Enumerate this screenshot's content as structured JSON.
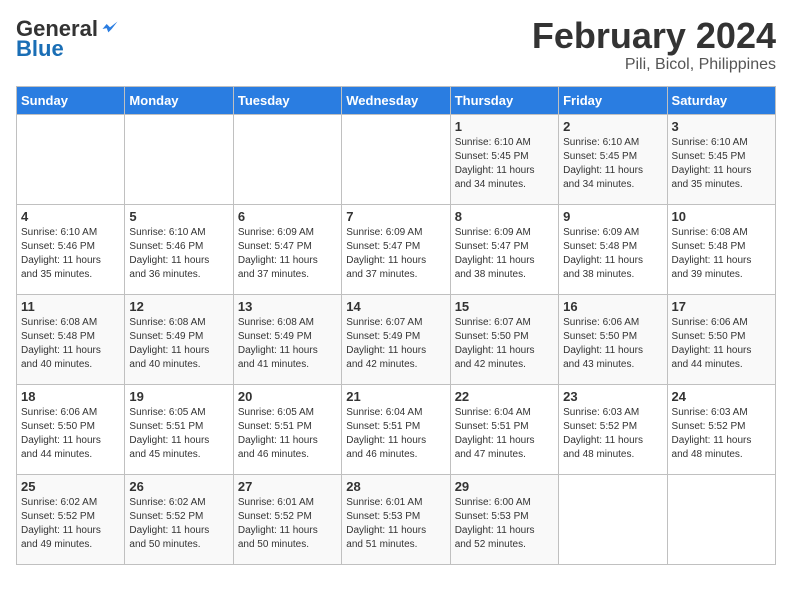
{
  "header": {
    "logo_general": "General",
    "logo_blue": "Blue",
    "title": "February 2024",
    "subtitle": "Pili, Bicol, Philippines"
  },
  "weekdays": [
    "Sunday",
    "Monday",
    "Tuesday",
    "Wednesday",
    "Thursday",
    "Friday",
    "Saturday"
  ],
  "weeks": [
    [
      {
        "day": "",
        "info": ""
      },
      {
        "day": "",
        "info": ""
      },
      {
        "day": "",
        "info": ""
      },
      {
        "day": "",
        "info": ""
      },
      {
        "day": "1",
        "info": "Sunrise: 6:10 AM\nSunset: 5:45 PM\nDaylight: 11 hours\nand 34 minutes."
      },
      {
        "day": "2",
        "info": "Sunrise: 6:10 AM\nSunset: 5:45 PM\nDaylight: 11 hours\nand 34 minutes."
      },
      {
        "day": "3",
        "info": "Sunrise: 6:10 AM\nSunset: 5:45 PM\nDaylight: 11 hours\nand 35 minutes."
      }
    ],
    [
      {
        "day": "4",
        "info": "Sunrise: 6:10 AM\nSunset: 5:46 PM\nDaylight: 11 hours\nand 35 minutes."
      },
      {
        "day": "5",
        "info": "Sunrise: 6:10 AM\nSunset: 5:46 PM\nDaylight: 11 hours\nand 36 minutes."
      },
      {
        "day": "6",
        "info": "Sunrise: 6:09 AM\nSunset: 5:47 PM\nDaylight: 11 hours\nand 37 minutes."
      },
      {
        "day": "7",
        "info": "Sunrise: 6:09 AM\nSunset: 5:47 PM\nDaylight: 11 hours\nand 37 minutes."
      },
      {
        "day": "8",
        "info": "Sunrise: 6:09 AM\nSunset: 5:47 PM\nDaylight: 11 hours\nand 38 minutes."
      },
      {
        "day": "9",
        "info": "Sunrise: 6:09 AM\nSunset: 5:48 PM\nDaylight: 11 hours\nand 38 minutes."
      },
      {
        "day": "10",
        "info": "Sunrise: 6:08 AM\nSunset: 5:48 PM\nDaylight: 11 hours\nand 39 minutes."
      }
    ],
    [
      {
        "day": "11",
        "info": "Sunrise: 6:08 AM\nSunset: 5:48 PM\nDaylight: 11 hours\nand 40 minutes."
      },
      {
        "day": "12",
        "info": "Sunrise: 6:08 AM\nSunset: 5:49 PM\nDaylight: 11 hours\nand 40 minutes."
      },
      {
        "day": "13",
        "info": "Sunrise: 6:08 AM\nSunset: 5:49 PM\nDaylight: 11 hours\nand 41 minutes."
      },
      {
        "day": "14",
        "info": "Sunrise: 6:07 AM\nSunset: 5:49 PM\nDaylight: 11 hours\nand 42 minutes."
      },
      {
        "day": "15",
        "info": "Sunrise: 6:07 AM\nSunset: 5:50 PM\nDaylight: 11 hours\nand 42 minutes."
      },
      {
        "day": "16",
        "info": "Sunrise: 6:06 AM\nSunset: 5:50 PM\nDaylight: 11 hours\nand 43 minutes."
      },
      {
        "day": "17",
        "info": "Sunrise: 6:06 AM\nSunset: 5:50 PM\nDaylight: 11 hours\nand 44 minutes."
      }
    ],
    [
      {
        "day": "18",
        "info": "Sunrise: 6:06 AM\nSunset: 5:50 PM\nDaylight: 11 hours\nand 44 minutes."
      },
      {
        "day": "19",
        "info": "Sunrise: 6:05 AM\nSunset: 5:51 PM\nDaylight: 11 hours\nand 45 minutes."
      },
      {
        "day": "20",
        "info": "Sunrise: 6:05 AM\nSunset: 5:51 PM\nDaylight: 11 hours\nand 46 minutes."
      },
      {
        "day": "21",
        "info": "Sunrise: 6:04 AM\nSunset: 5:51 PM\nDaylight: 11 hours\nand 46 minutes."
      },
      {
        "day": "22",
        "info": "Sunrise: 6:04 AM\nSunset: 5:51 PM\nDaylight: 11 hours\nand 47 minutes."
      },
      {
        "day": "23",
        "info": "Sunrise: 6:03 AM\nSunset: 5:52 PM\nDaylight: 11 hours\nand 48 minutes."
      },
      {
        "day": "24",
        "info": "Sunrise: 6:03 AM\nSunset: 5:52 PM\nDaylight: 11 hours\nand 48 minutes."
      }
    ],
    [
      {
        "day": "25",
        "info": "Sunrise: 6:02 AM\nSunset: 5:52 PM\nDaylight: 11 hours\nand 49 minutes."
      },
      {
        "day": "26",
        "info": "Sunrise: 6:02 AM\nSunset: 5:52 PM\nDaylight: 11 hours\nand 50 minutes."
      },
      {
        "day": "27",
        "info": "Sunrise: 6:01 AM\nSunset: 5:52 PM\nDaylight: 11 hours\nand 50 minutes."
      },
      {
        "day": "28",
        "info": "Sunrise: 6:01 AM\nSunset: 5:53 PM\nDaylight: 11 hours\nand 51 minutes."
      },
      {
        "day": "29",
        "info": "Sunrise: 6:00 AM\nSunset: 5:53 PM\nDaylight: 11 hours\nand 52 minutes."
      },
      {
        "day": "",
        "info": ""
      },
      {
        "day": "",
        "info": ""
      }
    ]
  ]
}
